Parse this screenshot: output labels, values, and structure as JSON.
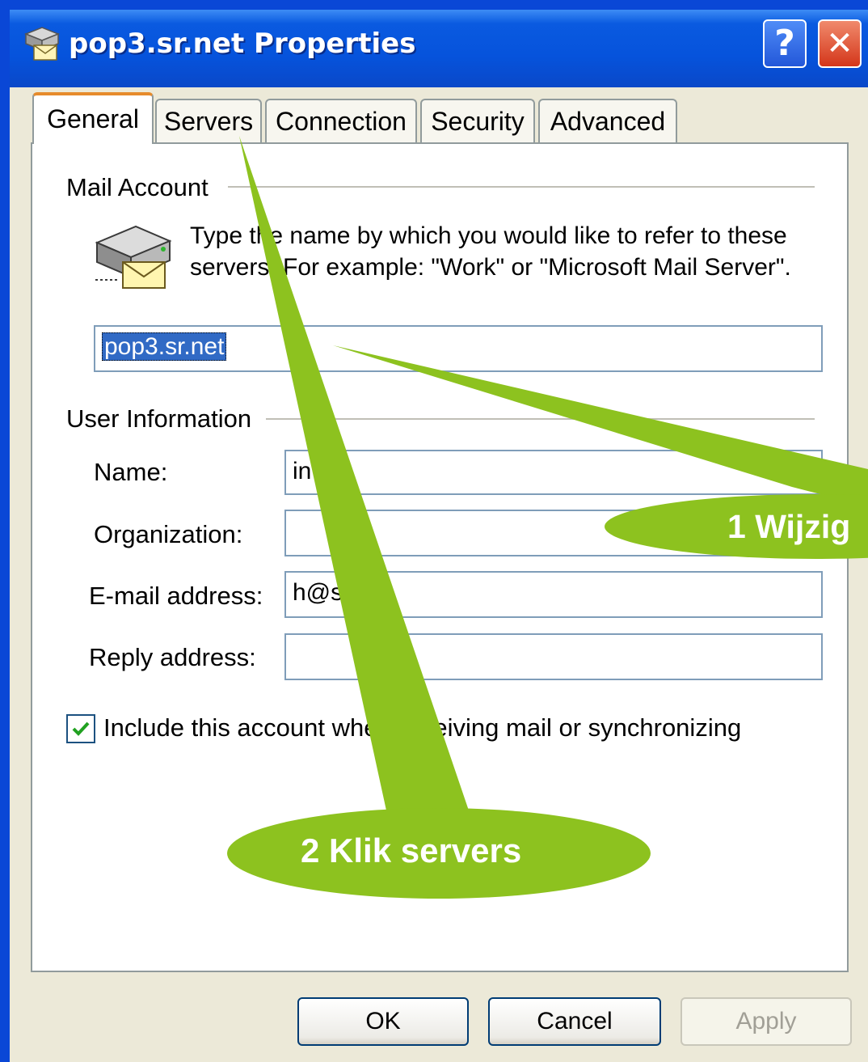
{
  "window": {
    "title": "pop3.sr.net Properties",
    "help_label": "?",
    "close_label": "✕"
  },
  "tabs": [
    {
      "label": "General",
      "active": true
    },
    {
      "label": "Servers",
      "active": false
    },
    {
      "label": "Connection",
      "active": false
    },
    {
      "label": "Security",
      "active": false
    },
    {
      "label": "Advanced",
      "active": false
    }
  ],
  "mail_account": {
    "heading": "Mail Account",
    "description": "Type the name by which you would like to refer to these servers. For example: \"Work\" or \"Microsoft Mail Server\".",
    "account_name_value": "pop3.sr.net"
  },
  "user_information": {
    "heading": "User Information",
    "name_label": "Name:",
    "name_value": "in",
    "organization_label": "Organization:",
    "organization_value": "",
    "email_label": "E-mail address:",
    "email_value": "h@s",
    "reply_label": "Reply address:",
    "reply_value": ""
  },
  "include_checkbox": {
    "label": "Include this account when receiving mail or synchronizing",
    "checked": true
  },
  "buttons": {
    "ok": "OK",
    "cancel": "Cancel",
    "apply": "Apply"
  },
  "callouts": {
    "callout_1": "1 Wijzig",
    "callout_2": "2 Klik servers",
    "color": "#8dc21f"
  },
  "colors": {
    "titlebar": "#0653dc",
    "active_tab_accent": "#e68b2c",
    "selection": "#316ac5"
  }
}
